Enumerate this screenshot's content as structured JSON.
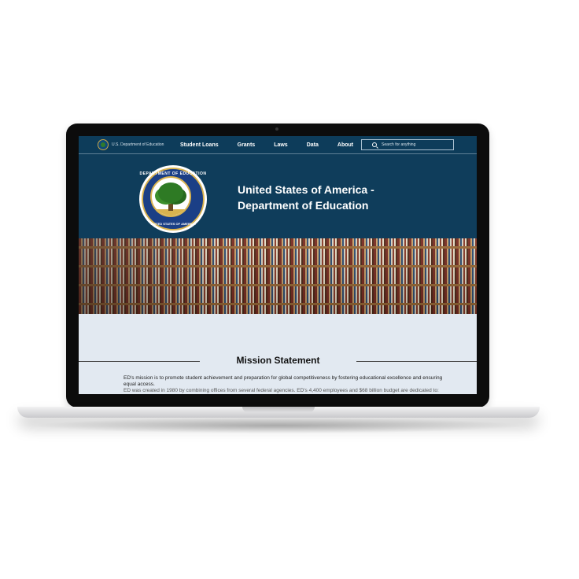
{
  "navbar": {
    "brand": "U.S. Department of Education",
    "links": [
      "Student Loans",
      "Grants",
      "Laws",
      "Data",
      "About"
    ],
    "search_placeholder": "Search for anything"
  },
  "hero": {
    "title_line1": "United States of America -",
    "title_line2": "Department of Education",
    "seal_top": "DEPARTMENT OF EDUCATION",
    "seal_bottom": "UNITED STATES OF AMERICA"
  },
  "mission": {
    "heading": "Mission Statement",
    "paragraph": "ED's mission is to promote student achievement and preparation for global competitiveness by fostering educational excellence and ensuring equal access.",
    "paragraph_partial": "ED was created in 1980 by combining offices from several federal agencies. ED's 4,400 employees and $68 billion budget are dedicated to:"
  },
  "colors": {
    "navbar": "#0d3c5a",
    "hero": "#0f3d5b",
    "mission_bg": "#e2e9f1",
    "seal_blue": "#1b3f86",
    "seal_gold": "#d9b34f"
  },
  "icons": [
    "search-icon",
    "department-seal-icon"
  ]
}
